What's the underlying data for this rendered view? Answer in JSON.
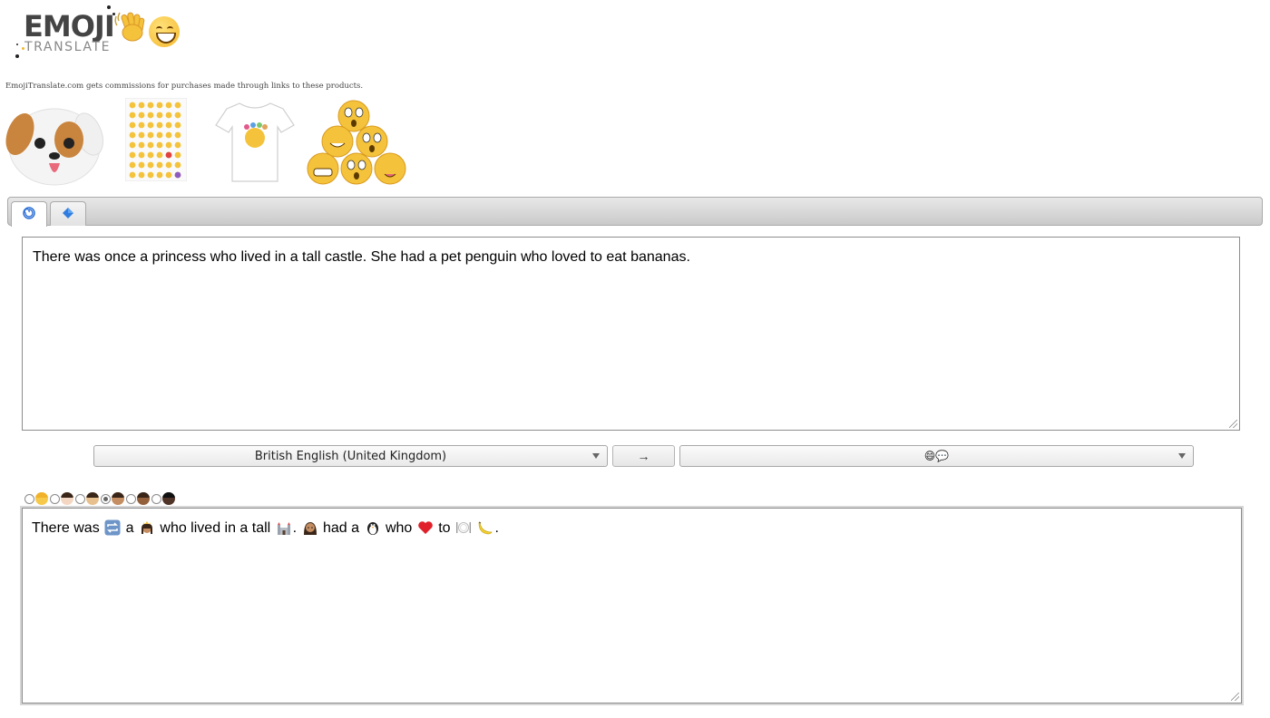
{
  "logo": {
    "word_top": "EMOJI",
    "word_bottom": "TRANSLATE"
  },
  "disclaimer": "EmojiTranslate.com gets commissions for purchases made through links to these products.",
  "products": [
    {
      "name": "dog-pillow"
    },
    {
      "name": "emoji-sticker-sheet"
    },
    {
      "name": "emoji-tshirt"
    },
    {
      "name": "emoji-plush-pile"
    }
  ],
  "tabs": [
    {
      "icon": "🌀",
      "active": true
    },
    {
      "icon": "🔷",
      "active": false
    }
  ],
  "source_text": "There was once a princess who lived in a tall castle. She had a pet penguin who loved to eat bananas.",
  "source_language": "British English (United Kingdom)",
  "swap_label": "→",
  "target_language": "😄💬",
  "skin_tones": [
    {
      "emoji": "👱",
      "checked": false,
      "color": "#f6c94a"
    },
    {
      "emoji": "👩🏻",
      "checked": false,
      "color": "#f3d7c3"
    },
    {
      "emoji": "👩🏼",
      "checked": false,
      "color": "#e7c08e"
    },
    {
      "emoji": "👩🏽",
      "checked": true,
      "color": "#c48e62"
    },
    {
      "emoji": "👩🏾",
      "checked": false,
      "color": "#93603b"
    },
    {
      "emoji": "👩🏿",
      "checked": false,
      "color": "#4f3427"
    }
  ],
  "output_segments": [
    {
      "type": "text",
      "value": "There was "
    },
    {
      "type": "icon",
      "icon": "repeat-icon"
    },
    {
      "type": "text",
      "value": " a "
    },
    {
      "type": "icon",
      "icon": "princess-icon"
    },
    {
      "type": "text",
      "value": " who lived in a tall "
    },
    {
      "type": "icon",
      "icon": "castle-icon"
    },
    {
      "type": "text",
      "value": ". "
    },
    {
      "type": "icon",
      "icon": "woman-icon"
    },
    {
      "type": "text",
      "value": " had a "
    },
    {
      "type": "icon",
      "icon": "penguin-icon"
    },
    {
      "type": "text",
      "value": " who "
    },
    {
      "type": "icon",
      "icon": "heart-icon"
    },
    {
      "type": "text",
      "value": " to "
    },
    {
      "type": "icon",
      "icon": "plate-icon"
    },
    {
      "type": "text",
      "value": " "
    },
    {
      "type": "icon",
      "icon": "banana-icon"
    },
    {
      "type": "text",
      "value": "."
    }
  ]
}
